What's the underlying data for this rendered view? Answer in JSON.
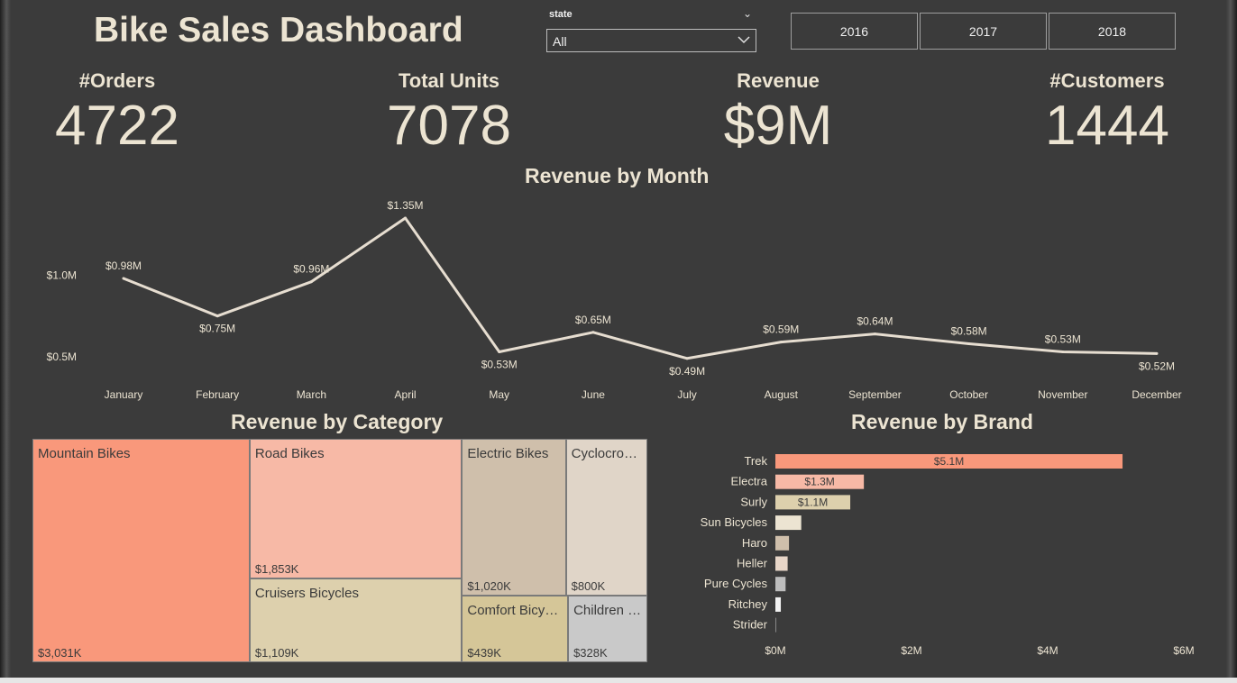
{
  "header": {
    "title": "Bike Sales Dashboard"
  },
  "slicer": {
    "label": "state",
    "value": "All"
  },
  "year_buttons": [
    "2016",
    "2017",
    "2018"
  ],
  "kpis": [
    {
      "label": "#Orders",
      "value": "4722"
    },
    {
      "label": "Total Units",
      "value": "7078"
    },
    {
      "label": "Revenue",
      "value": "$9M"
    },
    {
      "label": "#Customers",
      "value": "1444"
    }
  ],
  "colors": {
    "background": "#3b3b3b",
    "text": "#ece4d2",
    "line": "#e6ddd0",
    "salmon": "#f9987b",
    "light_salmon": "#f7b9a6",
    "tan": "#ddd0ad"
  },
  "chart_data": [
    {
      "type": "line",
      "title": "Revenue by Month",
      "x": [
        "January",
        "February",
        "March",
        "April",
        "May",
        "June",
        "July",
        "August",
        "September",
        "October",
        "November",
        "December"
      ],
      "values": [
        0.98,
        0.75,
        0.96,
        1.35,
        0.53,
        0.65,
        0.49,
        0.59,
        0.64,
        0.58,
        0.53,
        0.52
      ],
      "data_labels": [
        "$0.98M",
        "$0.75M",
        "$0.96M",
        "$1.35M",
        "$0.53M",
        "$0.65M",
        "$0.49M",
        "$0.59M",
        "$0.64M",
        "$0.58M",
        "$0.53M",
        "$0.52M"
      ],
      "label_position": [
        "above",
        "below",
        "above",
        "above",
        "below",
        "above",
        "below",
        "above",
        "above",
        "above",
        "above",
        "below"
      ],
      "y_ticks": [
        1.0,
        0.5
      ],
      "y_tick_labels": [
        "$1.0M",
        "$0.5M"
      ],
      "ylim": [
        0.45,
        1.4
      ],
      "grid": false
    },
    {
      "type": "treemap",
      "title": "Revenue by Category",
      "items": [
        {
          "name": "Mountain Bikes",
          "value": 3031,
          "label": "$3,031K",
          "color": "#f9987b"
        },
        {
          "name": "Road Bikes",
          "value": 1853,
          "label": "$1,853K",
          "color": "#f7b9a6"
        },
        {
          "name": "Cruisers Bicycles",
          "value": 1109,
          "label": "$1,109K",
          "color": "#ddd0ad"
        },
        {
          "name": "Electric Bikes",
          "value": 1020,
          "label": "$1,020K",
          "color": "#cfbfab"
        },
        {
          "name": "Comfort Bicycles",
          "value": 439,
          "label": "$439K",
          "color": "#d5c698"
        },
        {
          "name": "Cyclocross Bicycles",
          "value": 800,
          "label": "$800K",
          "color": "#e0d5c8"
        },
        {
          "name": "Children Bicycles",
          "value": 328,
          "label": "$328K",
          "color": "#c9c9c9"
        }
      ]
    },
    {
      "type": "bar",
      "orientation": "horizontal",
      "title": "Revenue by Brand",
      "categories": [
        "Trek",
        "Electra",
        "Surly",
        "Sun Bicycles",
        "Haro",
        "Heller",
        "Pure Cycles",
        "Ritchey",
        "Strider"
      ],
      "values": [
        5.1,
        1.3,
        1.1,
        0.38,
        0.2,
        0.18,
        0.15,
        0.08,
        0.005
      ],
      "data_labels": [
        "$5.1M",
        "$1.3M",
        "$1.1M",
        "",
        "",
        "",
        "",
        "",
        ""
      ],
      "bar_colors": [
        "#f9987b",
        "#f7b9a6",
        "#ddd0ad",
        "#ece4d2",
        "#cfbfab",
        "#e8d6c8",
        "#bdbdbd",
        "#f2f2f2",
        "#888888"
      ],
      "x_ticks": [
        0,
        2,
        4,
        6
      ],
      "x_tick_labels": [
        "$0M",
        "$2M",
        "$4M",
        "$6M"
      ],
      "xlim": [
        0,
        6
      ]
    }
  ]
}
